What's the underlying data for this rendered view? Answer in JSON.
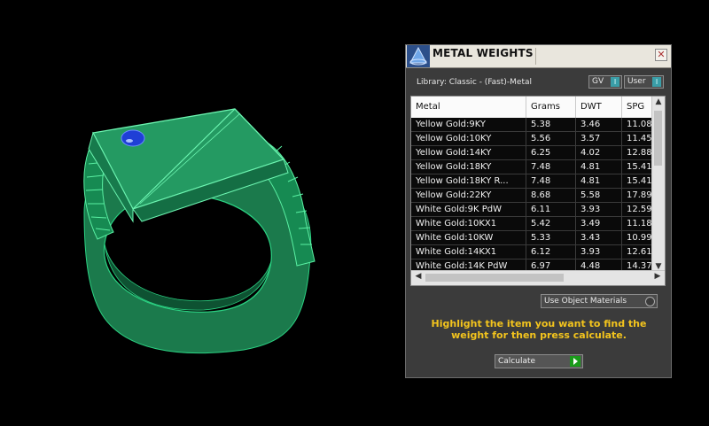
{
  "panel": {
    "title": "METAL WEIGHTS",
    "close_glyph": "✕",
    "library_label": "Library: Classic - (Fast)-Metal",
    "toggles": {
      "gv_label": "GV",
      "user_label": "User",
      "indicator_glyph": "I"
    },
    "table": {
      "headers": {
        "metal": "Metal",
        "grams": "Grams",
        "dwt": "DWT",
        "spg": "SPG"
      },
      "rows": [
        {
          "metal": "Yellow Gold:9KY",
          "grams": "5.38",
          "dwt": "3.46",
          "spg": "11.08"
        },
        {
          "metal": "Yellow Gold:10KY",
          "grams": "5.56",
          "dwt": "3.57",
          "spg": "11.45"
        },
        {
          "metal": "Yellow Gold:14KY",
          "grams": "6.25",
          "dwt": "4.02",
          "spg": "12.88"
        },
        {
          "metal": "Yellow Gold:18KY",
          "grams": "7.48",
          "dwt": "4.81",
          "spg": "15.41"
        },
        {
          "metal": "Yellow Gold:18KY R...",
          "grams": "7.48",
          "dwt": "4.81",
          "spg": "15.41"
        },
        {
          "metal": "Yellow Gold:22KY",
          "grams": "8.68",
          "dwt": "5.58",
          "spg": "17.89"
        },
        {
          "metal": "White Gold:9K PdW",
          "grams": "6.11",
          "dwt": "3.93",
          "spg": "12.59"
        },
        {
          "metal": "White Gold:10KX1",
          "grams": "5.42",
          "dwt": "3.49",
          "spg": "11.18"
        },
        {
          "metal": "White Gold:10KW",
          "grams": "5.33",
          "dwt": "3.43",
          "spg": "10.99"
        },
        {
          "metal": "White Gold:14KX1",
          "grams": "6.12",
          "dwt": "3.93",
          "spg": "12.61"
        },
        {
          "metal": "White Gold:14K PdW",
          "grams": "6.97",
          "dwt": "4.48",
          "spg": "14.37"
        }
      ]
    },
    "use_object_materials_label": "Use Object Materials",
    "hint_text": "Highlight the item you want to find the weight for then press calculate.",
    "calculate_label": "Calculate"
  },
  "colors": {
    "ring_green": "#1f8a55",
    "gem_blue": "#1f3fd6",
    "hint_yellow": "#f3c41d"
  }
}
